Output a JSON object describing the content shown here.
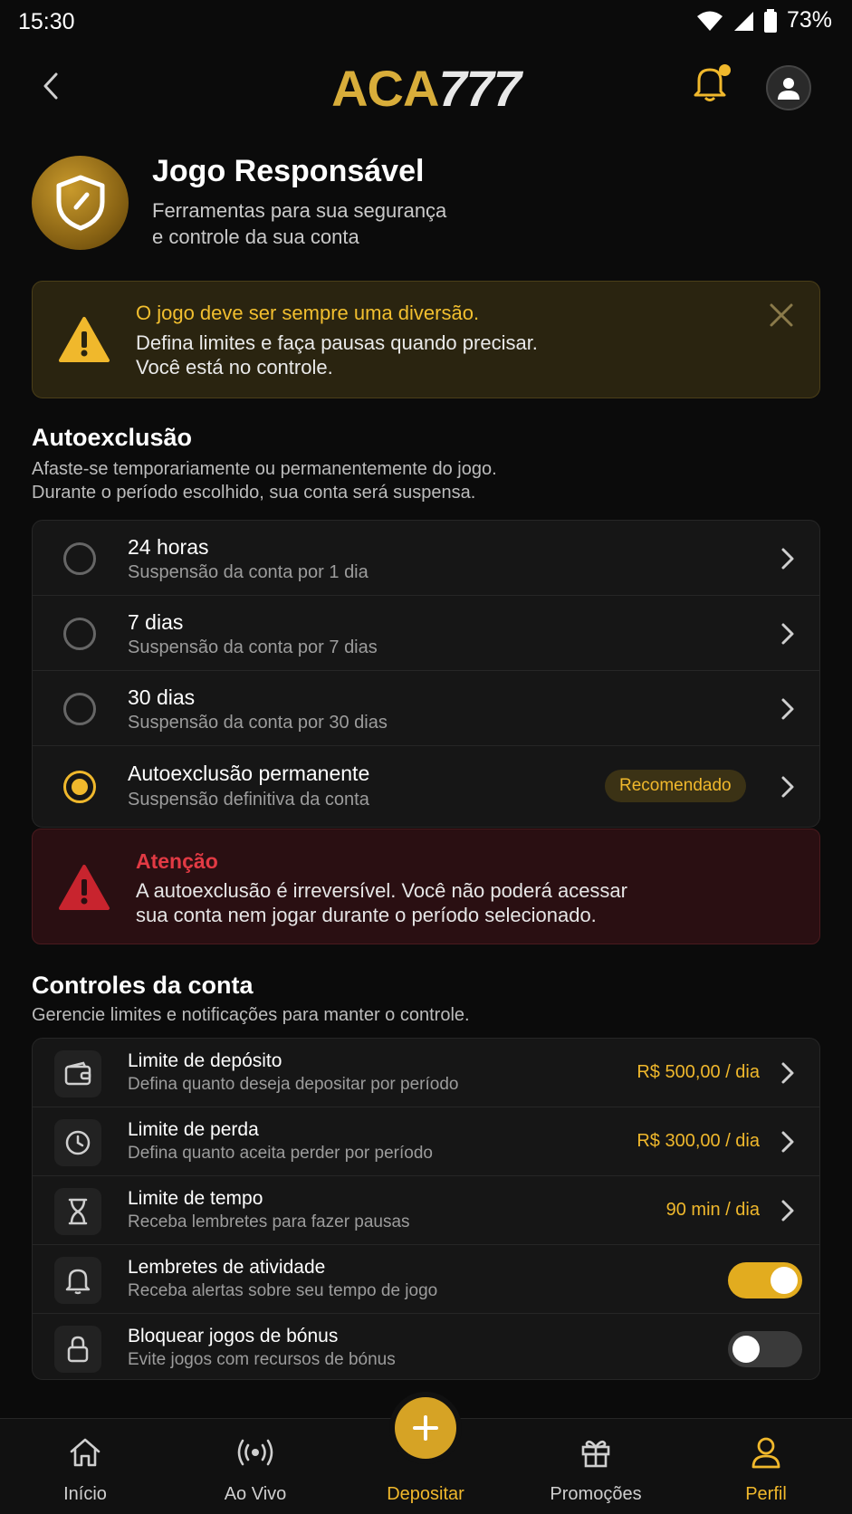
{
  "status_bar": {
    "time": "15:30",
    "battery": "73%"
  },
  "header": {
    "logo_left": "ACA",
    "logo_right": "777"
  },
  "hero": {
    "title": "Jogo Responsável",
    "subtitle_line1": "Ferramentas para sua segurança",
    "subtitle_line2": "e controle da sua conta"
  },
  "info_banner": {
    "title": "O jogo deve ser sempre uma diversão.",
    "line1": "Defina limites e faça pausas quando precisar.",
    "line2": "Você está no controle."
  },
  "self_exclusion": {
    "title": "Autoexclusão",
    "subtitle_line1": "Afaste-se temporariamente ou permanentemente do jogo.",
    "subtitle_line2": "Durante o período escolhido, sua conta será suspensa.",
    "options": [
      {
        "title": "24 horas",
        "subtitle": "Suspensão da conta por 1 dia",
        "selected": false
      },
      {
        "title": "7 dias",
        "subtitle": "Suspensão da conta por 7 dias",
        "selected": false
      },
      {
        "title": "30 dias",
        "subtitle": "Suspensão da conta por 30 dias",
        "selected": false
      },
      {
        "title": "Autoexclusão permanente",
        "subtitle": "Suspensão definitiva da conta",
        "selected": true,
        "badge": "Recomendado"
      }
    ],
    "warning": {
      "title": "Atenção",
      "line1": "A autoexclusão é irreversível. Você não poderá acessar",
      "line2": "sua conta nem jogar durante o período selecionado."
    }
  },
  "controls": {
    "title": "Controles da conta",
    "subtitle": "Gerencie limites e notificações para manter o controle.",
    "items": [
      {
        "title": "Limite de depósito",
        "subtitle": "Defina quanto deseja depositar por período",
        "value": "R$ 500,00 / dia",
        "icon": "wallet-icon"
      },
      {
        "title": "Limite de perda",
        "subtitle": "Defina quanto aceita perder por período",
        "value": "R$ 300,00 / dia",
        "icon": "clock-icon"
      },
      {
        "title": "Limite de tempo",
        "subtitle": "Receba lembretes para fazer pausas",
        "value": "90 min / dia",
        "icon": "hourglass-icon"
      },
      {
        "title": "Lembretes de atividade",
        "subtitle": "Receba alertas sobre seu tempo de jogo",
        "toggle": true,
        "icon": "bell-icon"
      },
      {
        "title": "Bloquear jogos de bónus",
        "subtitle": "Evite jogos com recursos de bónus",
        "toggle": false,
        "icon": "lock-icon"
      }
    ]
  },
  "bottom_nav": {
    "items": [
      {
        "label": "Início",
        "icon": "home-icon"
      },
      {
        "label": "Ao Vivo",
        "icon": "live-icon"
      },
      {
        "label": "Depositar",
        "icon": "plus-icon"
      },
      {
        "label": "Promoções",
        "icon": "gift-icon"
      },
      {
        "label": "Perfil",
        "icon": "user-icon"
      }
    ]
  },
  "colors": {
    "accent": "#f0b82c",
    "danger": "#e23a44",
    "background": "#0b0b0b"
  }
}
